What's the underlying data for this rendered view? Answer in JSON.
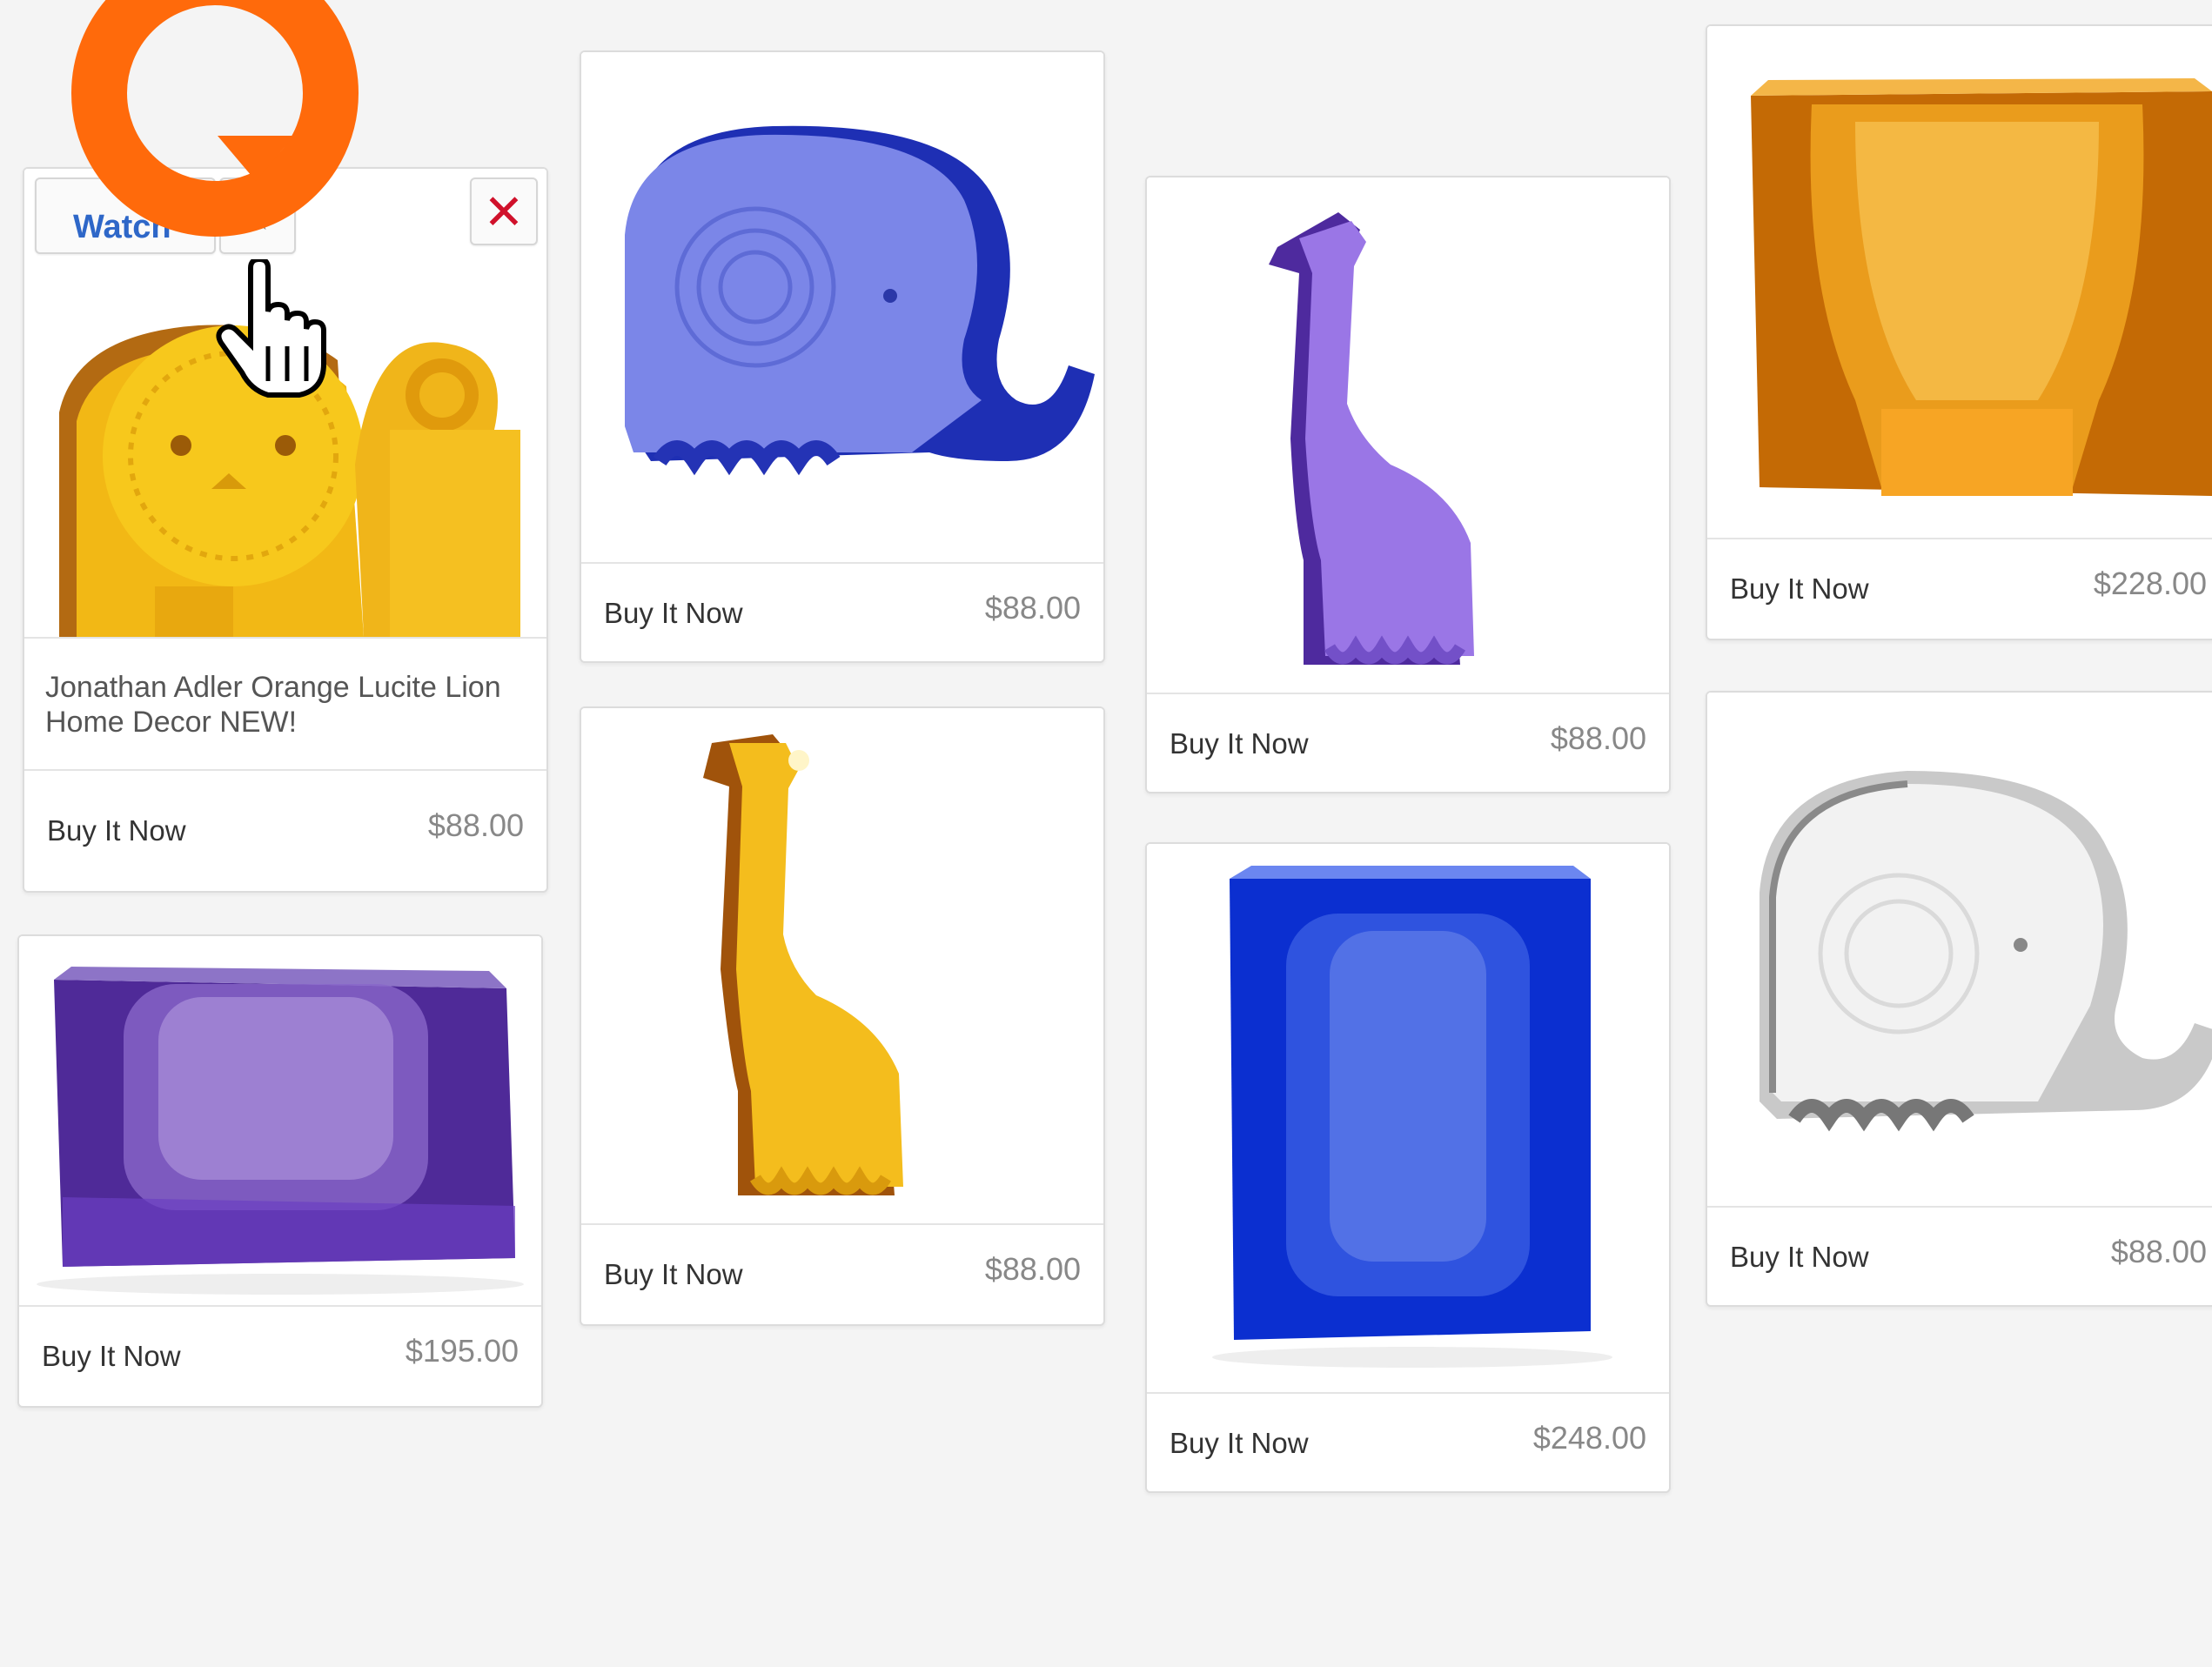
{
  "cards": [
    {
      "id": "lion",
      "title": "Jonathan Adler Orange Lucite Lion Home Decor NEW!",
      "buy": "Buy It Now",
      "price": "$88.00"
    },
    {
      "id": "purple-vase",
      "buy": "Buy It Now",
      "price": "$195.00"
    },
    {
      "id": "blue-elephant",
      "buy": "Buy It Now",
      "price": "$88.00"
    },
    {
      "id": "amber-giraffe",
      "buy": "Buy It Now",
      "price": "$88.00"
    },
    {
      "id": "purple-giraffe",
      "buy": "Buy It Now",
      "price": "$88.00"
    },
    {
      "id": "blue-vase",
      "buy": "Buy It Now",
      "price": "$248.00"
    },
    {
      "id": "amber-vase",
      "buy": "Buy It Now",
      "price": "$228.00"
    },
    {
      "id": "clear-elephant",
      "buy": "Buy It Now",
      "price": "$88.00"
    }
  ],
  "toolbar": {
    "watch_label": "Watch",
    "star_icon": "star-icon",
    "close_icon": "close-icon"
  },
  "highlight": {
    "color": "#ff6a0b"
  }
}
